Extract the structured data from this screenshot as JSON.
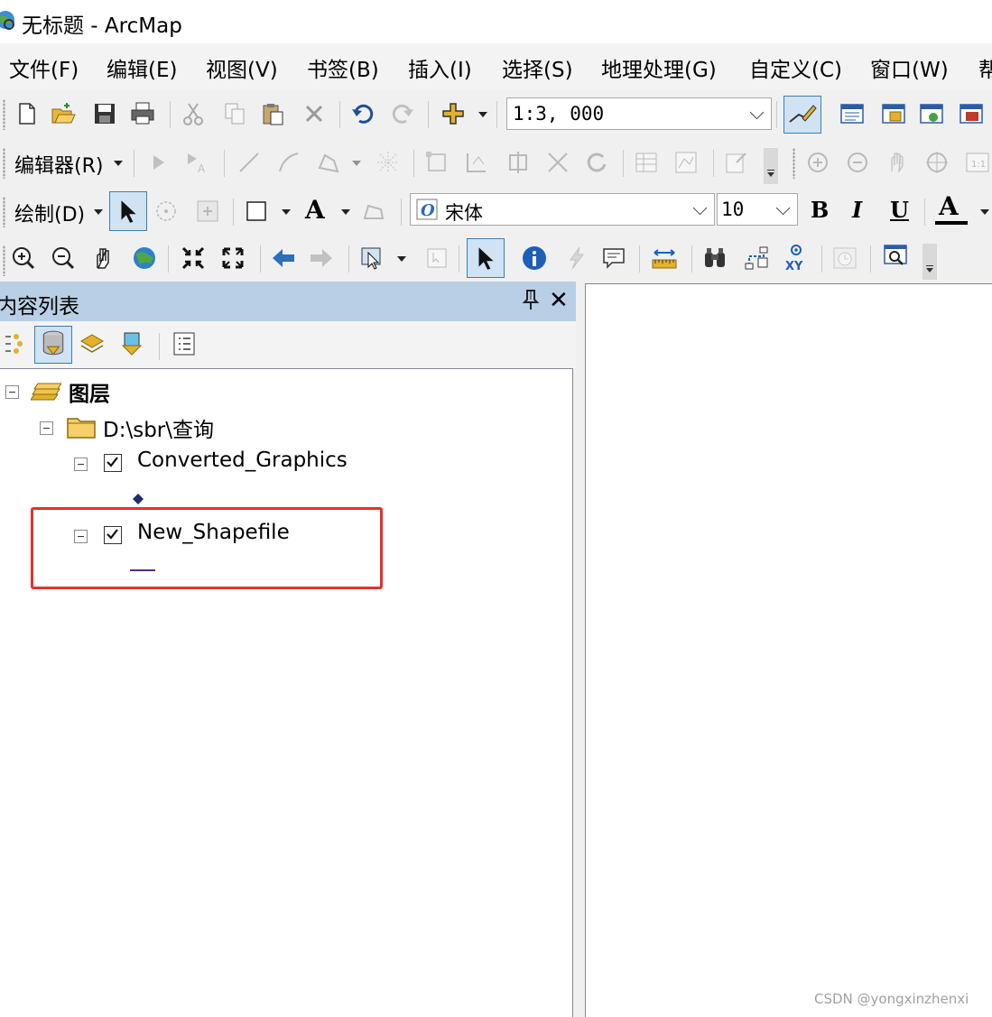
{
  "window": {
    "title": "无标题 - ArcMap"
  },
  "menu": [
    "文件(F)",
    "编辑(E)",
    "视图(V)",
    "书签(B)",
    "插入(I)",
    "选择(S)",
    "地理处理(G)",
    "自定义(C)",
    "窗口(W)",
    "帮"
  ],
  "standard_toolbar": {
    "scale_value": "1:3, 000"
  },
  "editor_toolbar": {
    "label": "编辑器(R)"
  },
  "draw_toolbar": {
    "label": "绘制(D)",
    "font_name": "宋体",
    "font_size": "10",
    "bold": "B",
    "italic": "I",
    "underline": "U",
    "font_color": "A",
    "text_tool": "A"
  },
  "tools_toolbar": {
    "xy_label": "XY"
  },
  "toc": {
    "title": "内容列表",
    "pin": "ᵖ",
    "close": "✕",
    "root": "图层",
    "folder": "D:\\sbr\\查询",
    "layers": [
      {
        "name": "Converted_Graphics",
        "checked": true,
        "symbol": "point"
      },
      {
        "name": "New_Shapefile",
        "checked": true,
        "symbol": "line",
        "symbol_color": "#5b2a86"
      }
    ],
    "highlight_color": "#e8302a"
  },
  "watermark": "CSDN @yongxinzhenxi"
}
